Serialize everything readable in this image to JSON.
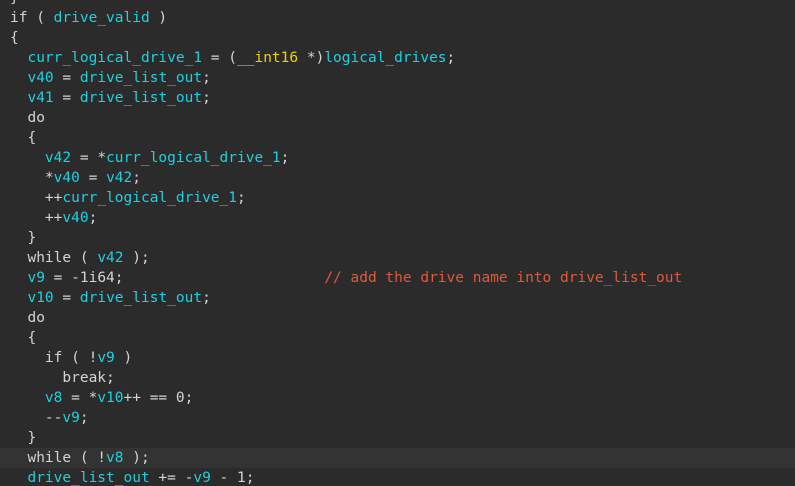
{
  "colors": {
    "background": "#2b2b2b",
    "current_line": "#333333",
    "identifier": "#1fd0e0",
    "keyword": "#d4d4d4",
    "punctuation": "#d4d4d4",
    "type": "#f0d000",
    "comment": "#e05a3a"
  },
  "lines": [
    {
      "tokens": [
        {
          "t": "}",
          "c": "punctuation"
        }
      ]
    },
    {
      "tokens": [
        {
          "t": "if ( ",
          "c": "keyword"
        },
        {
          "t": "drive_valid",
          "c": "identifier"
        },
        {
          "t": " )",
          "c": "punctuation"
        }
      ]
    },
    {
      "tokens": [
        {
          "t": "{",
          "c": "punctuation"
        }
      ]
    },
    {
      "tokens": [
        {
          "t": "  ",
          "c": "punctuation"
        },
        {
          "t": "curr_logical_drive_1",
          "c": "identifier"
        },
        {
          "t": " = (",
          "c": "punctuation"
        },
        {
          "t": "__int16",
          "c": "type"
        },
        {
          "t": " *)",
          "c": "punctuation"
        },
        {
          "t": "logical_drives",
          "c": "identifier"
        },
        {
          "t": ";",
          "c": "punctuation"
        }
      ]
    },
    {
      "tokens": [
        {
          "t": "  ",
          "c": "punctuation"
        },
        {
          "t": "v40",
          "c": "identifier"
        },
        {
          "t": " = ",
          "c": "punctuation"
        },
        {
          "t": "drive_list_out",
          "c": "identifier"
        },
        {
          "t": ";",
          "c": "punctuation"
        }
      ]
    },
    {
      "tokens": [
        {
          "t": "  ",
          "c": "punctuation"
        },
        {
          "t": "v41",
          "c": "identifier"
        },
        {
          "t": " = ",
          "c": "punctuation"
        },
        {
          "t": "drive_list_out",
          "c": "identifier"
        },
        {
          "t": ";",
          "c": "punctuation"
        }
      ]
    },
    {
      "tokens": [
        {
          "t": "  do",
          "c": "keyword"
        }
      ]
    },
    {
      "tokens": [
        {
          "t": "  {",
          "c": "punctuation"
        }
      ]
    },
    {
      "tokens": [
        {
          "t": "    ",
          "c": "punctuation"
        },
        {
          "t": "v42",
          "c": "identifier"
        },
        {
          "t": " = *",
          "c": "punctuation"
        },
        {
          "t": "curr_logical_drive_1",
          "c": "identifier"
        },
        {
          "t": ";",
          "c": "punctuation"
        }
      ]
    },
    {
      "tokens": [
        {
          "t": "    *",
          "c": "punctuation"
        },
        {
          "t": "v40",
          "c": "identifier"
        },
        {
          "t": " = ",
          "c": "punctuation"
        },
        {
          "t": "v42",
          "c": "identifier"
        },
        {
          "t": ";",
          "c": "punctuation"
        }
      ]
    },
    {
      "tokens": [
        {
          "t": "    ++",
          "c": "punctuation"
        },
        {
          "t": "curr_logical_drive_1",
          "c": "identifier"
        },
        {
          "t": ";",
          "c": "punctuation"
        }
      ]
    },
    {
      "tokens": [
        {
          "t": "    ++",
          "c": "punctuation"
        },
        {
          "t": "v40",
          "c": "identifier"
        },
        {
          "t": ";",
          "c": "punctuation"
        }
      ]
    },
    {
      "tokens": [
        {
          "t": "  }",
          "c": "punctuation"
        }
      ]
    },
    {
      "tokens": [
        {
          "t": "  while ( ",
          "c": "keyword"
        },
        {
          "t": "v42",
          "c": "identifier"
        },
        {
          "t": " );",
          "c": "punctuation"
        }
      ]
    },
    {
      "tokens": [
        {
          "t": "  ",
          "c": "punctuation"
        },
        {
          "t": "v9",
          "c": "identifier"
        },
        {
          "t": " = -1i64;",
          "c": "punctuation"
        },
        {
          "t": "                       ",
          "c": "punctuation"
        },
        {
          "t": "// add the drive name into drive_list_out",
          "c": "comment"
        }
      ]
    },
    {
      "tokens": [
        {
          "t": "  ",
          "c": "punctuation"
        },
        {
          "t": "v10",
          "c": "identifier"
        },
        {
          "t": " = ",
          "c": "punctuation"
        },
        {
          "t": "drive_list_out",
          "c": "identifier"
        },
        {
          "t": ";",
          "c": "punctuation"
        }
      ]
    },
    {
      "tokens": [
        {
          "t": "  do",
          "c": "keyword"
        }
      ]
    },
    {
      "tokens": [
        {
          "t": "  {",
          "c": "punctuation"
        }
      ]
    },
    {
      "tokens": [
        {
          "t": "    if ( !",
          "c": "keyword"
        },
        {
          "t": "v9",
          "c": "identifier"
        },
        {
          "t": " )",
          "c": "punctuation"
        }
      ]
    },
    {
      "tokens": [
        {
          "t": "      break;",
          "c": "keyword"
        }
      ]
    },
    {
      "tokens": [
        {
          "t": "    ",
          "c": "punctuation"
        },
        {
          "t": "v8",
          "c": "identifier"
        },
        {
          "t": " = *",
          "c": "punctuation"
        },
        {
          "t": "v10",
          "c": "identifier"
        },
        {
          "t": "++ == 0;",
          "c": "punctuation"
        }
      ]
    },
    {
      "tokens": [
        {
          "t": "    --",
          "c": "punctuation"
        },
        {
          "t": "v9",
          "c": "identifier"
        },
        {
          "t": ";",
          "c": "punctuation"
        }
      ]
    },
    {
      "tokens": [
        {
          "t": "  }",
          "c": "punctuation"
        }
      ]
    },
    {
      "tokens": [
        {
          "t": "  while ( !",
          "c": "keyword"
        },
        {
          "t": "v8",
          "c": "identifier"
        },
        {
          "t": " );",
          "c": "punctuation"
        }
      ],
      "highlight": true
    },
    {
      "tokens": [
        {
          "t": "  ",
          "c": "punctuation"
        },
        {
          "t": "drive_list_out",
          "c": "identifier"
        },
        {
          "t": " += -",
          "c": "punctuation"
        },
        {
          "t": "v9",
          "c": "identifier"
        },
        {
          "t": " - 1;",
          "c": "punctuation"
        }
      ]
    }
  ]
}
